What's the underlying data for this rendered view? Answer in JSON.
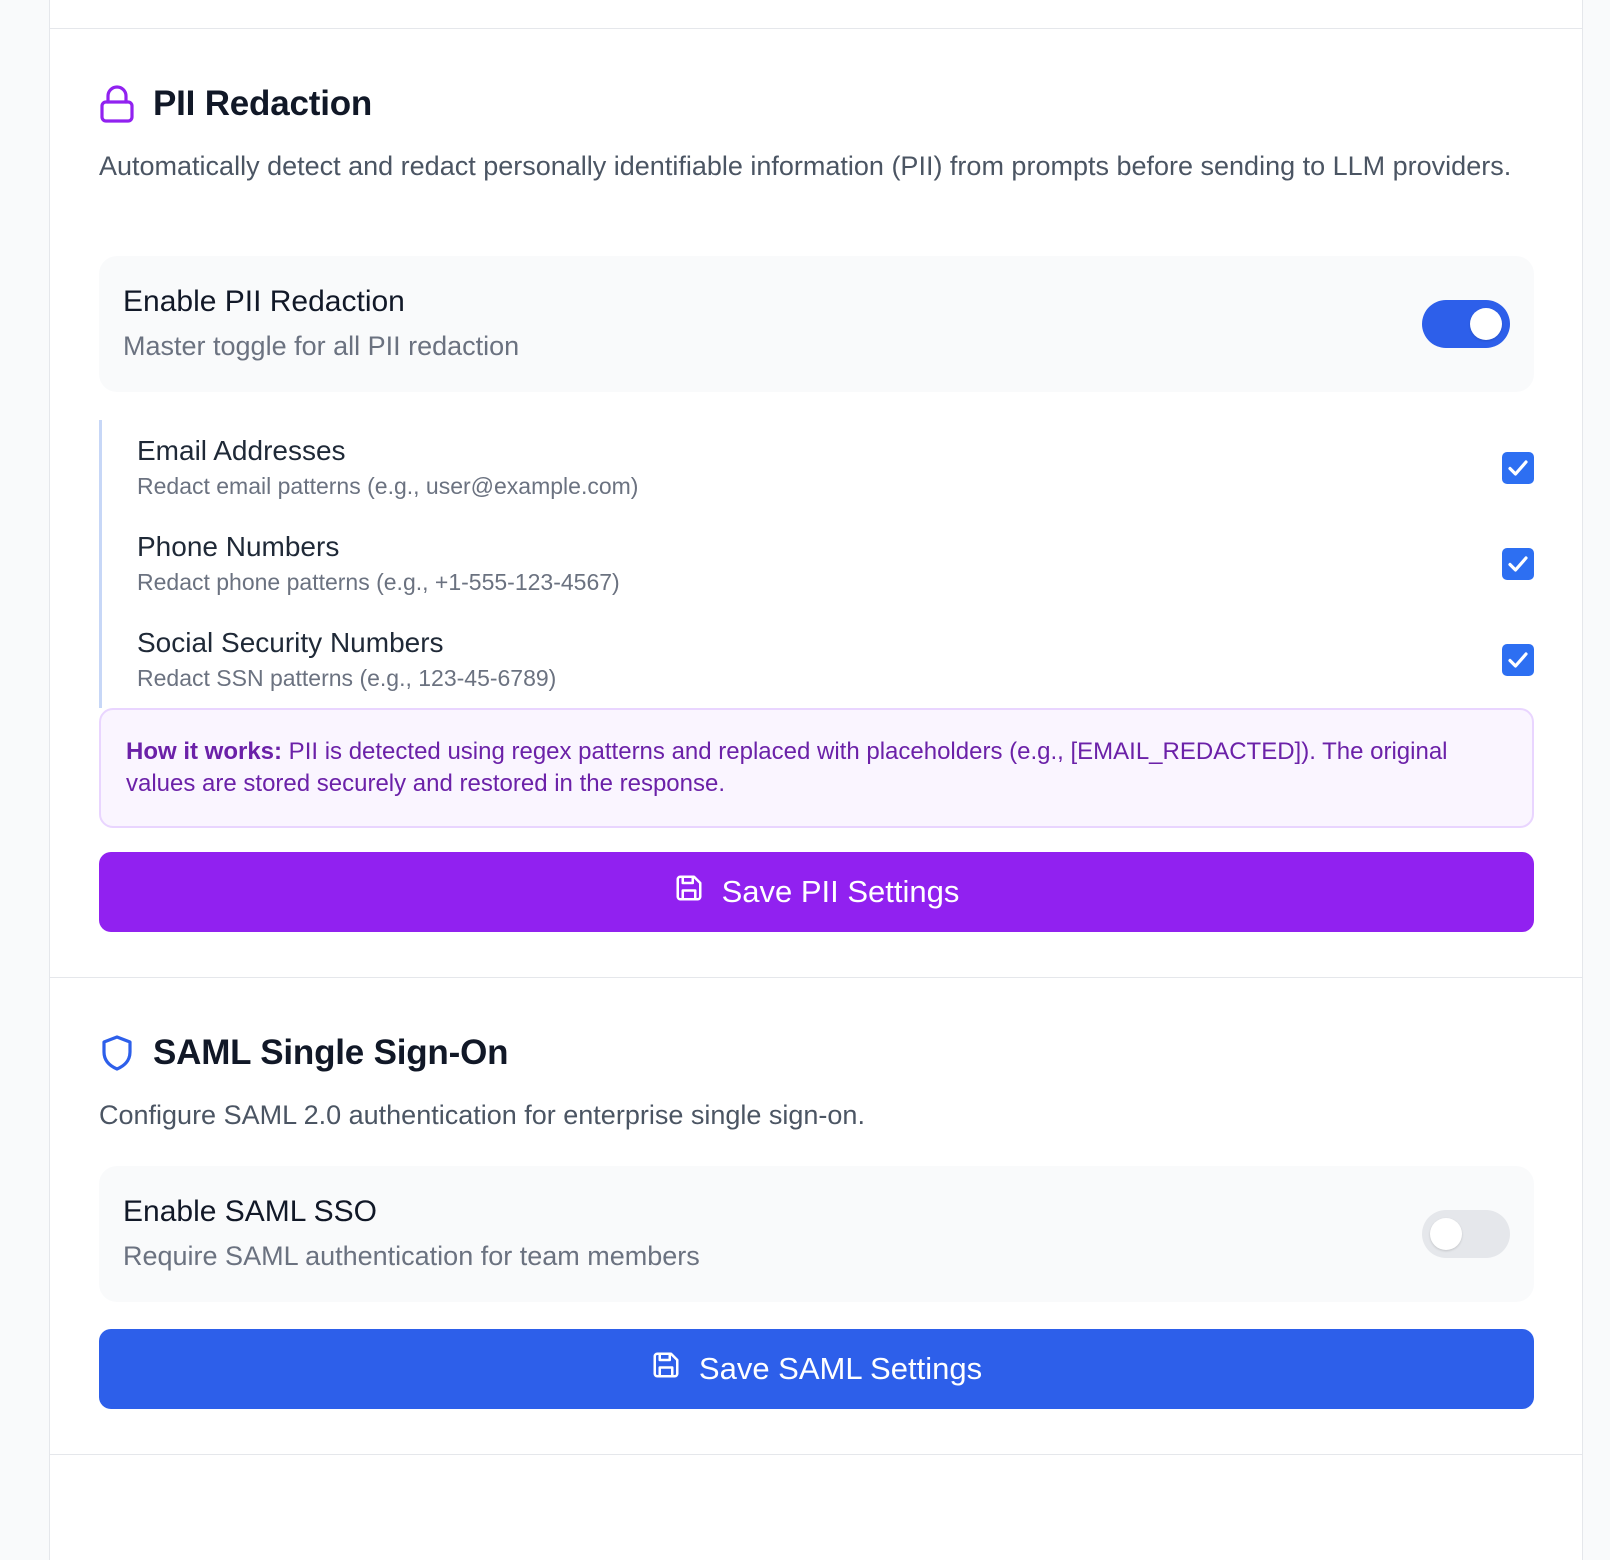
{
  "colors": {
    "purple_accent": "#9121f0",
    "blue_accent": "#2d5fea",
    "toggle_off": "#e5e7eb",
    "info_bg": "#faf5ff",
    "info_text": "#6b21a8"
  },
  "pii": {
    "icon": "lock-icon",
    "title": "PII Redaction",
    "description": "Automatically detect and redact personally identifiable information (PII) from prompts before sending to LLM providers.",
    "master_toggle": {
      "title": "Enable PII Redaction",
      "subtitle": "Master toggle for all PII redaction",
      "enabled": true
    },
    "options": [
      {
        "title": "Email Addresses",
        "subtitle": "Redact email patterns (e.g., user@example.com)",
        "checked": true
      },
      {
        "title": "Phone Numbers",
        "subtitle": "Redact phone patterns (e.g., +1-555-123-4567)",
        "checked": true
      },
      {
        "title": "Social Security Numbers",
        "subtitle": "Redact SSN patterns (e.g., 123-45-6789)",
        "checked": true
      }
    ],
    "info": {
      "label": "How it works:",
      "text": " PII is detected using regex patterns and replaced with placeholders (e.g., [EMAIL_REDACTED]). The original values are stored securely and restored in the response."
    },
    "save_icon": "save-icon",
    "save_label": "Save PII Settings"
  },
  "saml": {
    "icon": "shield-icon",
    "title": "SAML Single Sign-On",
    "description": "Configure SAML 2.0 authentication for enterprise single sign-on.",
    "toggle": {
      "title": "Enable SAML SSO",
      "subtitle": "Require SAML authentication for team members",
      "enabled": false
    },
    "save_icon": "save-icon",
    "save_label": "Save SAML Settings"
  }
}
